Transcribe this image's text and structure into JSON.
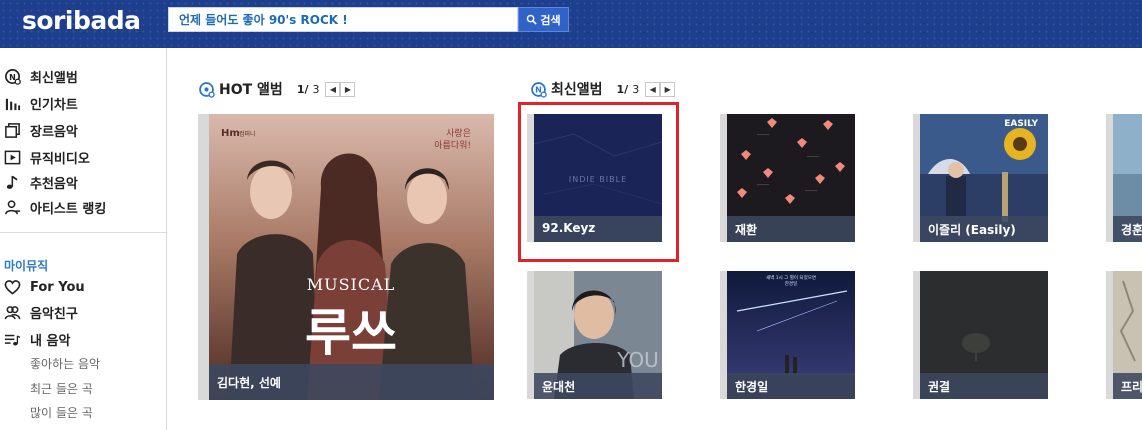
{
  "header": {
    "logo": "soribada",
    "search_value": "언제 들어도 좋아 90's ROCK !",
    "search_button": "검색"
  },
  "sidebar": {
    "items": [
      {
        "label": "최신앨범",
        "icon": "new-album-icon"
      },
      {
        "label": "인기차트",
        "icon": "chart-bars-icon"
      },
      {
        "label": "장르음악",
        "icon": "genre-squares-icon"
      },
      {
        "label": "뮤직비디오",
        "icon": "play-box-icon"
      },
      {
        "label": "추천음악",
        "icon": "music-note-icon"
      },
      {
        "label": "아티스트 랭킹",
        "icon": "artist-person-icon"
      }
    ],
    "my_music_title": "마이뮤직",
    "my_items": [
      {
        "label": "For You",
        "icon": "heart-icon"
      },
      {
        "label": "음악친구",
        "icon": "friends-icon"
      },
      {
        "label": "내 음악",
        "icon": "playlist-icon"
      }
    ],
    "sub_items": [
      "좋아하는 음악",
      "최근 들은 곡",
      "많이 들은 곡"
    ]
  },
  "hot": {
    "title": "HOT 앨범",
    "page_current": "1/",
    "page_total": "3",
    "album": {
      "label": "김다현, 선예",
      "art_text_musical": "MUSICAL",
      "art_text_title": "루쓰",
      "art_text_brand": "Hm",
      "art_text_brand_small": "컴퍼니",
      "art_text_quote": "사랑은\n아름다워!"
    }
  },
  "new": {
    "title": "최신앨범",
    "page_current": "1/",
    "page_total": "3",
    "albums": [
      {
        "label": "92.Keyz",
        "art_text": "INDIE BIBLE"
      },
      {
        "label": "재환"
      },
      {
        "label": "이즐리 (Easily)",
        "art_text": "EASILY"
      },
      {
        "label": "경훈"
      },
      {
        "label": "윤대천",
        "art_text": "YOU"
      },
      {
        "label": "한경일",
        "art_text": "새벽 1시 그 별이 되었으면\n한경일"
      },
      {
        "label": "권결"
      },
      {
        "label": "프리"
      }
    ]
  },
  "colors": {
    "header_bg": "#1d3f8e",
    "accent_blue": "#2b78c8",
    "highlight_red": "#e0222a",
    "label_bg": "#3c4860"
  }
}
